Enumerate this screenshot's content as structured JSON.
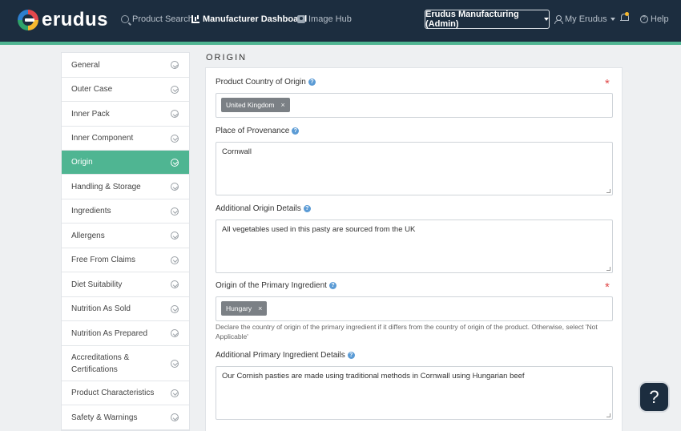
{
  "header": {
    "logo_text": "erudus",
    "nav": [
      {
        "label": "Product Search",
        "icon": "search-icon"
      },
      {
        "label": "Manufacturer Dashboard",
        "icon": "chart-icon",
        "active": true
      },
      {
        "label": "Image Hub",
        "icon": "camera-icon"
      }
    ],
    "company_selector": "Erudus Manufacturing (Admin)",
    "my_erudus": "My Erudus",
    "help": "Help",
    "accent_color": "#4fb592",
    "bar_color": "#1c2d3f"
  },
  "sidebar": {
    "items": [
      {
        "label": "General"
      },
      {
        "label": "Outer Case"
      },
      {
        "label": "Inner Pack"
      },
      {
        "label": "Inner Component"
      },
      {
        "label": "Origin",
        "active": true
      },
      {
        "label": "Handling & Storage"
      },
      {
        "label": "Ingredients"
      },
      {
        "label": "Allergens"
      },
      {
        "label": "Free From Claims"
      },
      {
        "label": "Diet Suitability"
      },
      {
        "label": "Nutrition As Sold"
      },
      {
        "label": "Nutrition As Prepared"
      },
      {
        "label_line1": "Accreditations &",
        "label_line2": "Certifications"
      },
      {
        "label": "Product Characteristics"
      },
      {
        "label": "Safety & Warnings"
      }
    ]
  },
  "main": {
    "section_title": "ORIGIN",
    "fields": {
      "country_of_origin": {
        "label": "Product Country of Origin",
        "required": "*",
        "tags": [
          "United Kingdom"
        ]
      },
      "place_of_provenance": {
        "label": "Place of Provenance",
        "value": "Cornwall"
      },
      "additional_origin": {
        "label": "Additional Origin Details",
        "value": "All vegetables used in this pasty are sourced from the UK"
      },
      "primary_ingredient_origin": {
        "label": "Origin of the Primary Ingredient",
        "required": "*",
        "tags": [
          "Hungary"
        ],
        "hint": "Declare the country of origin of the primary ingredient if it differs from the country of origin of the product. Otherwise, select 'Not Applicable'"
      },
      "additional_primary": {
        "label": "Additional Primary Ingredient Details",
        "value": "Our Cornish pasties are made using traditional methods in Cornwall using Hungarian beef"
      }
    },
    "tag_remove": "×",
    "info_glyph": "?"
  },
  "help_fab": "?"
}
